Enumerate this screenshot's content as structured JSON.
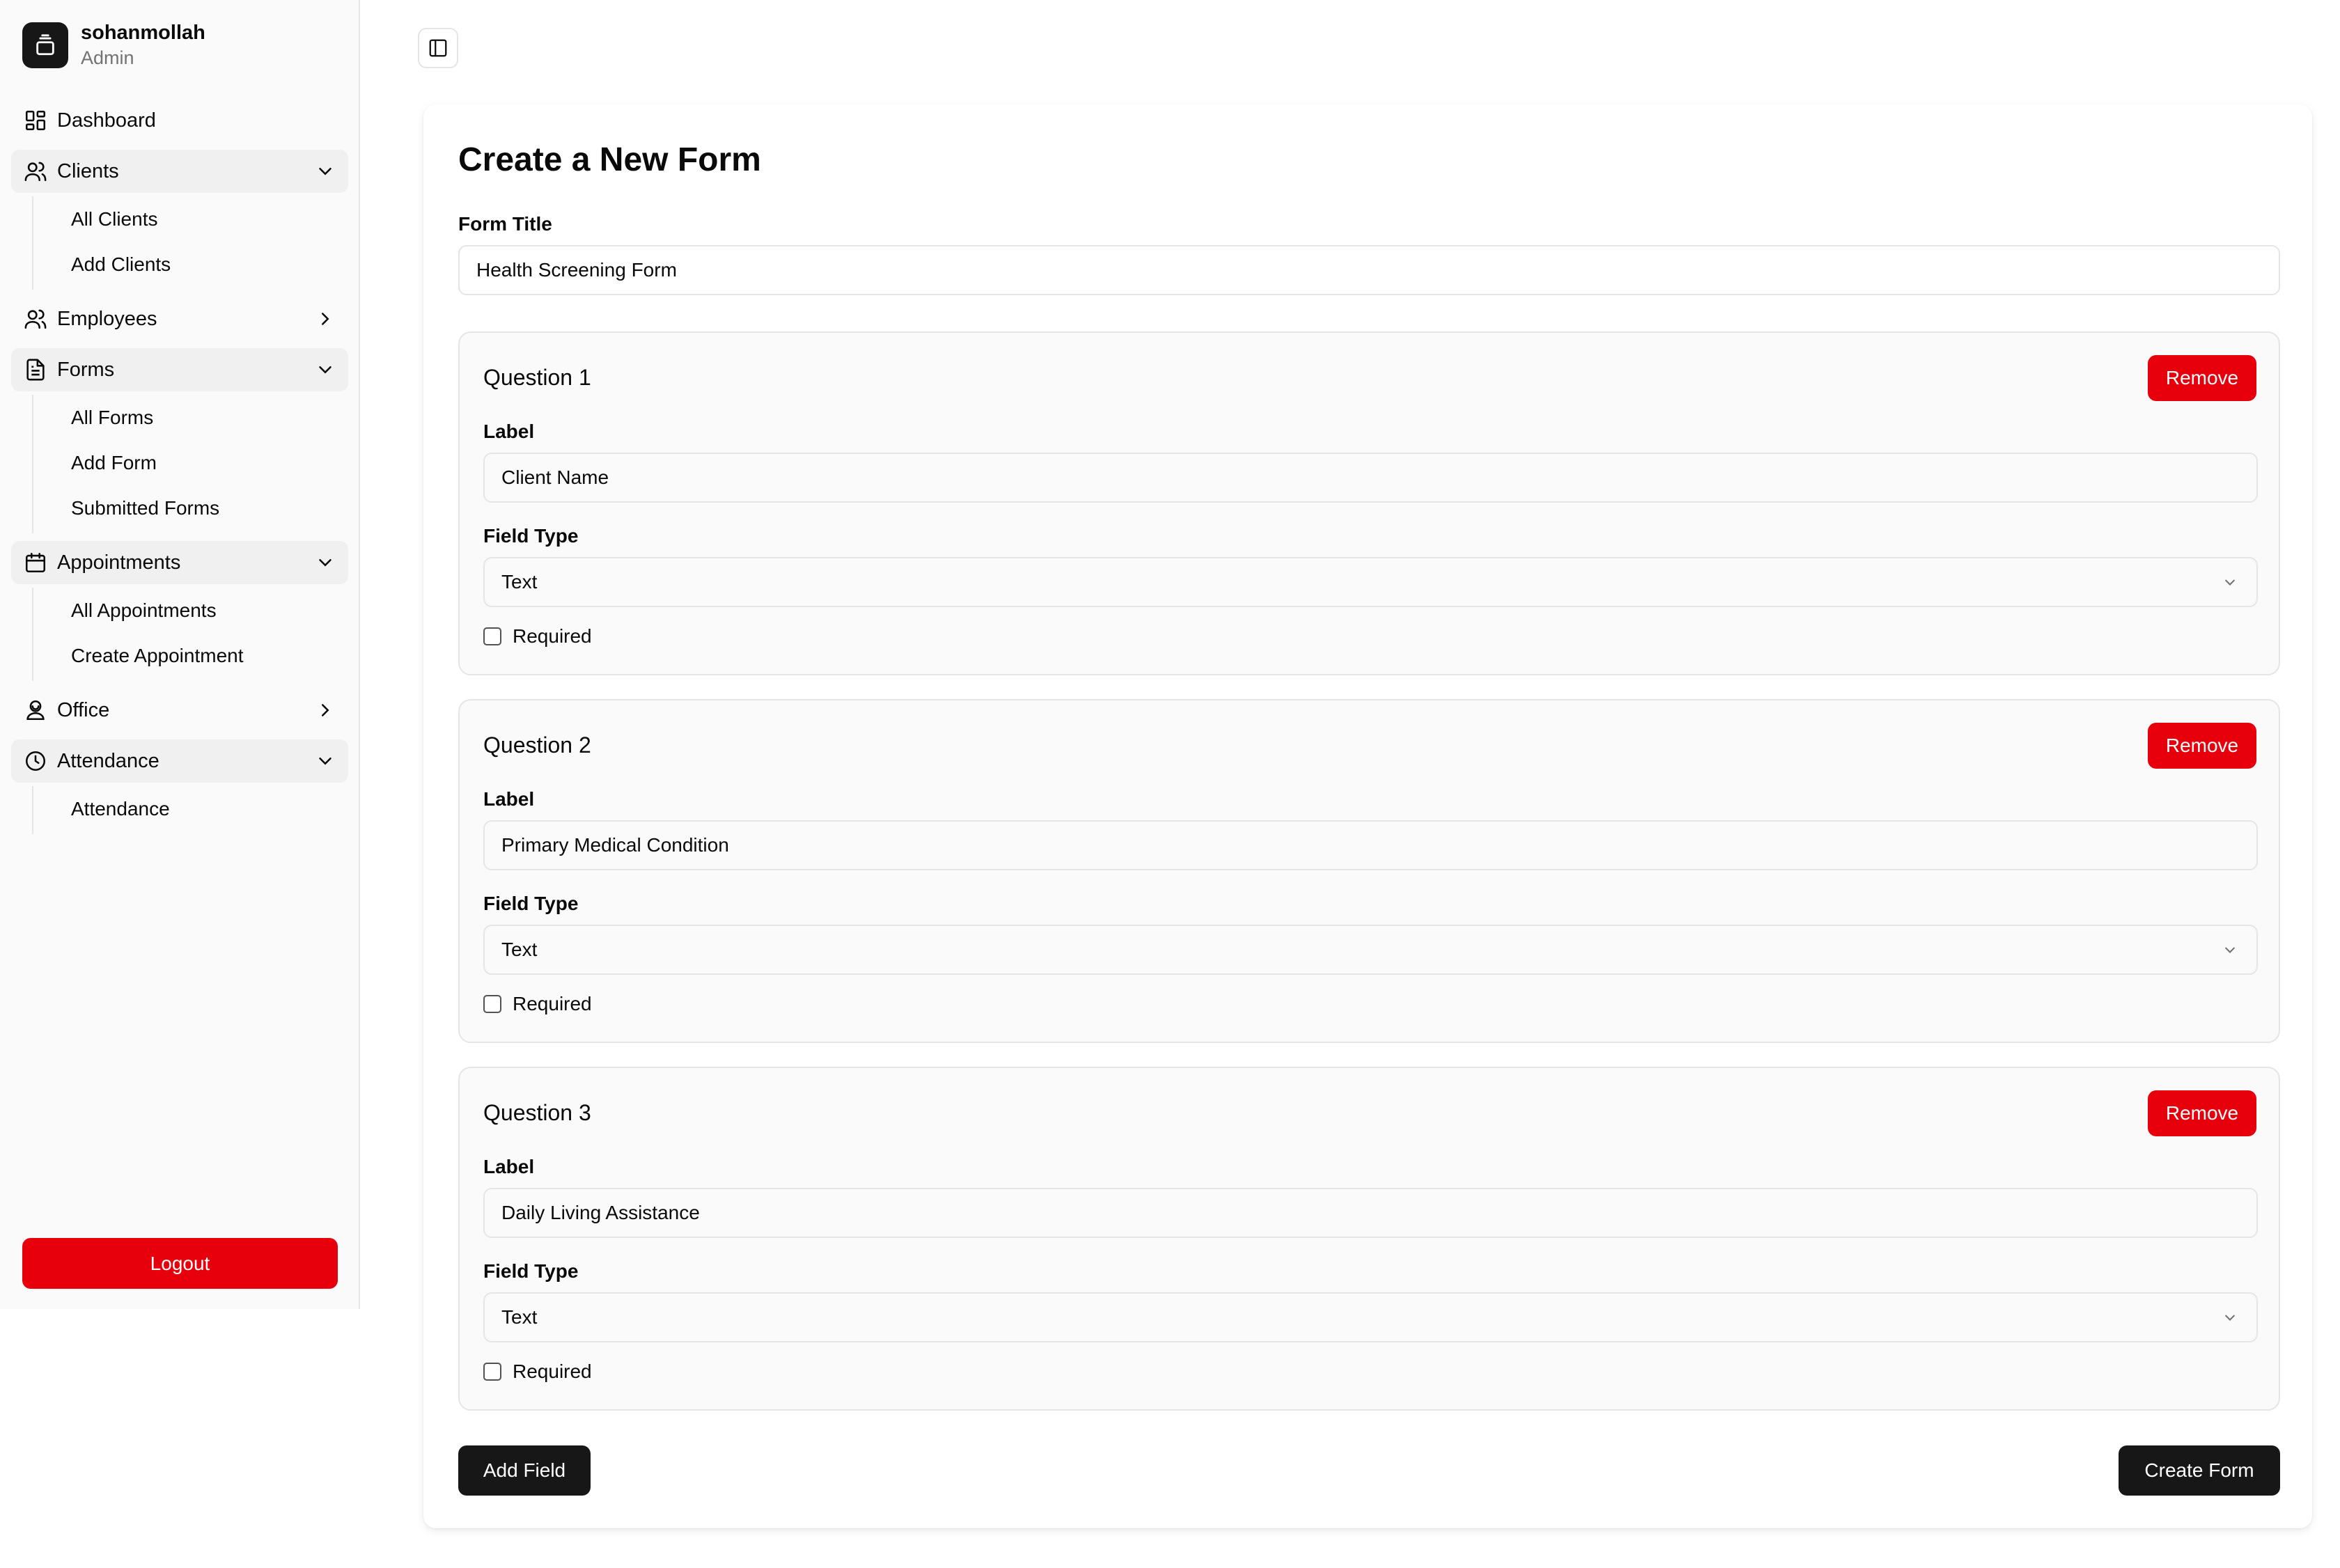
{
  "user": {
    "name": "sohanmollah",
    "role": "Admin"
  },
  "nav": {
    "dashboard": "Dashboard",
    "clients": {
      "label": "Clients",
      "items": [
        "All Clients",
        "Add Clients"
      ]
    },
    "employees": "Employees",
    "forms": {
      "label": "Forms",
      "items": [
        "All Forms",
        "Add Form",
        "Submitted Forms"
      ]
    },
    "appointments": {
      "label": "Appointments",
      "items": [
        "All Appointments",
        "Create Appointment"
      ]
    },
    "office": "Office",
    "attendance": {
      "label": "Attendance",
      "items": [
        "Attendance"
      ]
    }
  },
  "logout_label": "Logout",
  "form": {
    "heading": "Create a New Form",
    "title_label": "Form Title",
    "title_value": "Health Screening Form",
    "label_caption": "Label",
    "field_type_caption": "Field Type",
    "required_caption": "Required",
    "remove_label": "Remove",
    "questions": [
      {
        "title": "Question 1",
        "label": "Client Name",
        "type": "Text",
        "required": false
      },
      {
        "title": "Question 2",
        "label": "Primary Medical Condition",
        "type": "Text",
        "required": false
      },
      {
        "title": "Question 3",
        "label": "Daily Living Assistance",
        "type": "Text",
        "required": false
      }
    ],
    "add_field_label": "Add Field",
    "create_label": "Create Form"
  },
  "colors": {
    "danger": "#e7000b",
    "dark": "#171717",
    "border": "#e5e5e5",
    "sidebar_bg": "#fafafa"
  }
}
